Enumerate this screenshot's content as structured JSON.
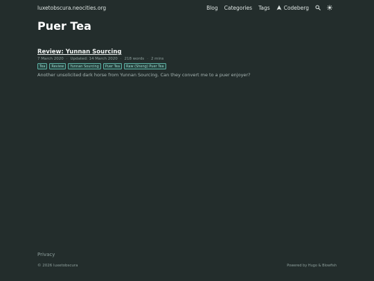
{
  "header": {
    "site_title": "luxetobscura.neocities.org",
    "nav": [
      {
        "label": "Blog"
      },
      {
        "label": "Categories"
      },
      {
        "label": "Tags"
      },
      {
        "label": "Codeberg",
        "icon": "codeberg-icon"
      }
    ],
    "icons": [
      "search-icon",
      "theme-toggle-icon"
    ]
  },
  "main": {
    "page_title": "Puer Tea",
    "article": {
      "title": "Review: Yunnan Sourcing",
      "date": "7 March 2020",
      "updated": "Updated: 14 March 2020",
      "words": "218 words",
      "reading_time": "2 mins",
      "tags": [
        "Tea",
        "Review",
        "Yunnan Sourcing",
        "Puer Tea",
        "Raw (Sheng) Puer Tea"
      ],
      "summary": "Another unsolicited dark horse from Yunnan Sourcing. Can they convert me to a puer enjoyer?"
    }
  },
  "footer": {
    "privacy": "Privacy",
    "copyright": "© 2026 luxetobscura",
    "powered": "Powered by Hugo & Blowfish"
  },
  "colors": {
    "background": "#232d2c",
    "accent": "#5fb3a6"
  }
}
